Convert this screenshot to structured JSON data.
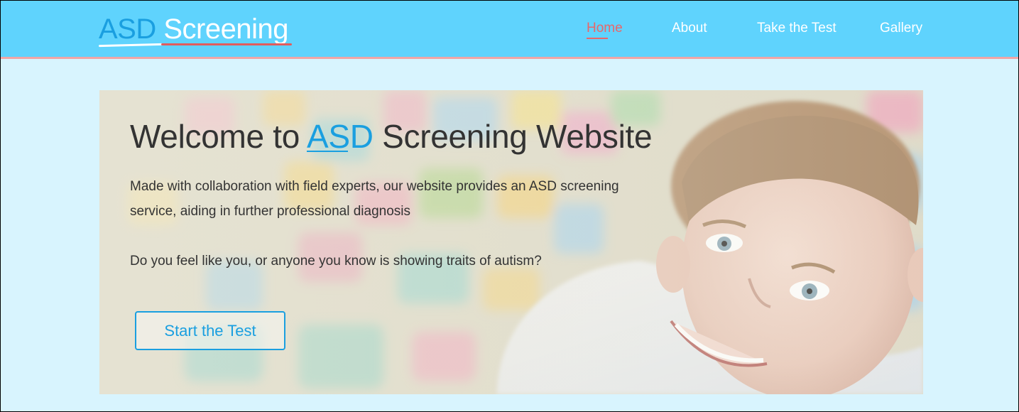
{
  "brand": {
    "logo_part1": "ASD",
    "logo_part2": "Screening",
    "accent_color": "#1a9fe0",
    "header_color": "#5fd3fd",
    "page_bg": "#d8f4fe",
    "highlight_color": "#e8676a"
  },
  "nav": {
    "items": [
      {
        "label": "Home",
        "active": true
      },
      {
        "label": "About",
        "active": false
      },
      {
        "label": "Take the Test",
        "active": false
      },
      {
        "label": "Gallery",
        "active": false
      }
    ]
  },
  "hero": {
    "title_before": "Welcome to ",
    "title_accent": "ASD",
    "title_after": " Screening Website",
    "description": "Made with collaboration with field experts, our website provides an ASD screening service, aiding in further professional diagnosis",
    "question": "Do you feel like you, or anyone you know is showing traits of autism?",
    "cta_label": "Start the Test",
    "image": "smiling-child-puzzle-background"
  }
}
